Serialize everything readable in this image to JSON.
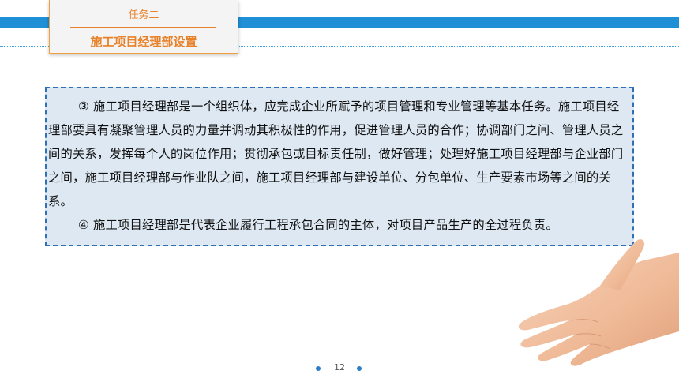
{
  "header": {
    "subtitle": "任务二",
    "title": "施工项目经理部设置"
  },
  "content": {
    "paragraph1": "③ 施工项目经理部是一个组织体，应完成企业所赋予的项目管理和专业管理等基本任务。施工项目经理部要具有凝聚管理人员的力量并调动其积极性的作用，促进管理人员的合作；协调部门之间、管理人员之间的关系，发挥每个人的岗位作用；贯彻承包或目标责任制，做好管理；处理好施工项目经理部与企业部门之间，施工项目经理部与作业队之间，施工项目经理部与建设单位、分包单位、生产要素市场等之间的关系。",
    "paragraph2": "④ 施工项目经理部是代表企业履行工程承包合同的主体，对项目产品生产的全过程负责。"
  },
  "footer": {
    "page_number": "12"
  },
  "colors": {
    "accent_blue": "#1f8fd6",
    "accent_orange": "#e8822a",
    "box_fill": "#dde8f2",
    "box_border": "#2e6fb8"
  }
}
